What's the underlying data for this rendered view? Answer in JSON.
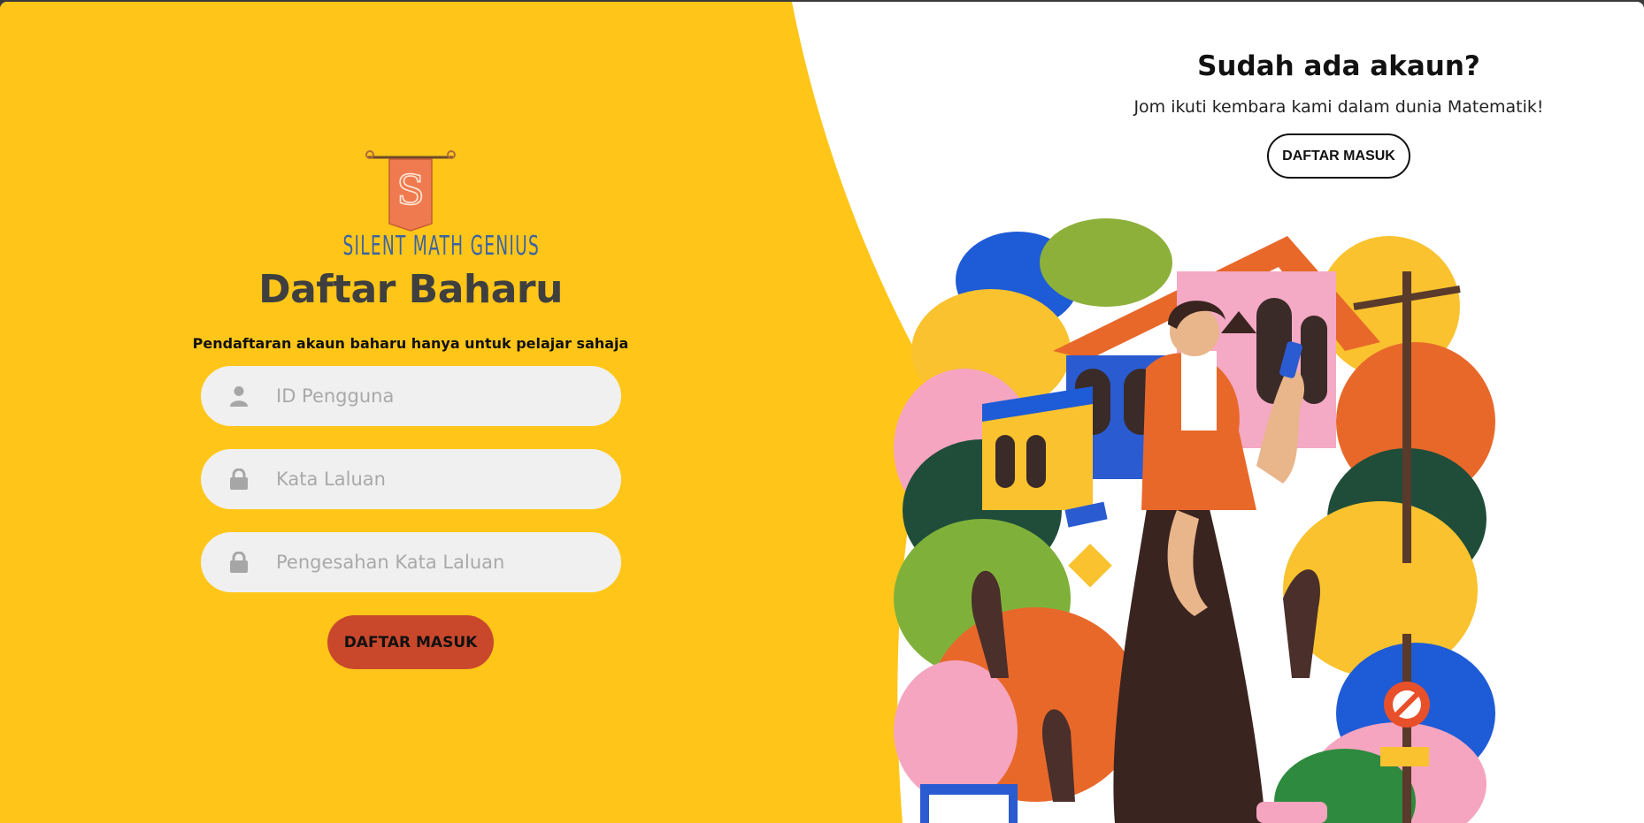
{
  "brand": {
    "name": "SILENT MATH GENIUS",
    "logo_letter": "S",
    "logo_icon": "banner-logo-icon"
  },
  "register": {
    "title": "Daftar Baharu",
    "subtitle": "Pendaftaran akaun baharu hanya untuk pelajar sahaja",
    "fields": {
      "user_id": {
        "placeholder": "ID Pengguna",
        "value": "",
        "icon": "user-icon"
      },
      "password": {
        "placeholder": "Kata Laluan",
        "value": "",
        "icon": "lock-icon"
      },
      "confirm_password": {
        "placeholder": "Pengesahan Kata Laluan",
        "value": "",
        "icon": "lock-icon"
      }
    },
    "submit_label": "DAFTAR MASUK"
  },
  "login_panel": {
    "heading": "Sudah ada akaun?",
    "text": "Jom ikuti kembara kami dalam dunia Matematik!",
    "button_label": "DAFTAR MASUK"
  },
  "colors": {
    "panel_yellow": "#FFC619",
    "field_bg": "#F0F0F0",
    "register_button": "#C9482C",
    "title_text": "#3F3F3F",
    "brand_blue": "#3C63A3"
  }
}
